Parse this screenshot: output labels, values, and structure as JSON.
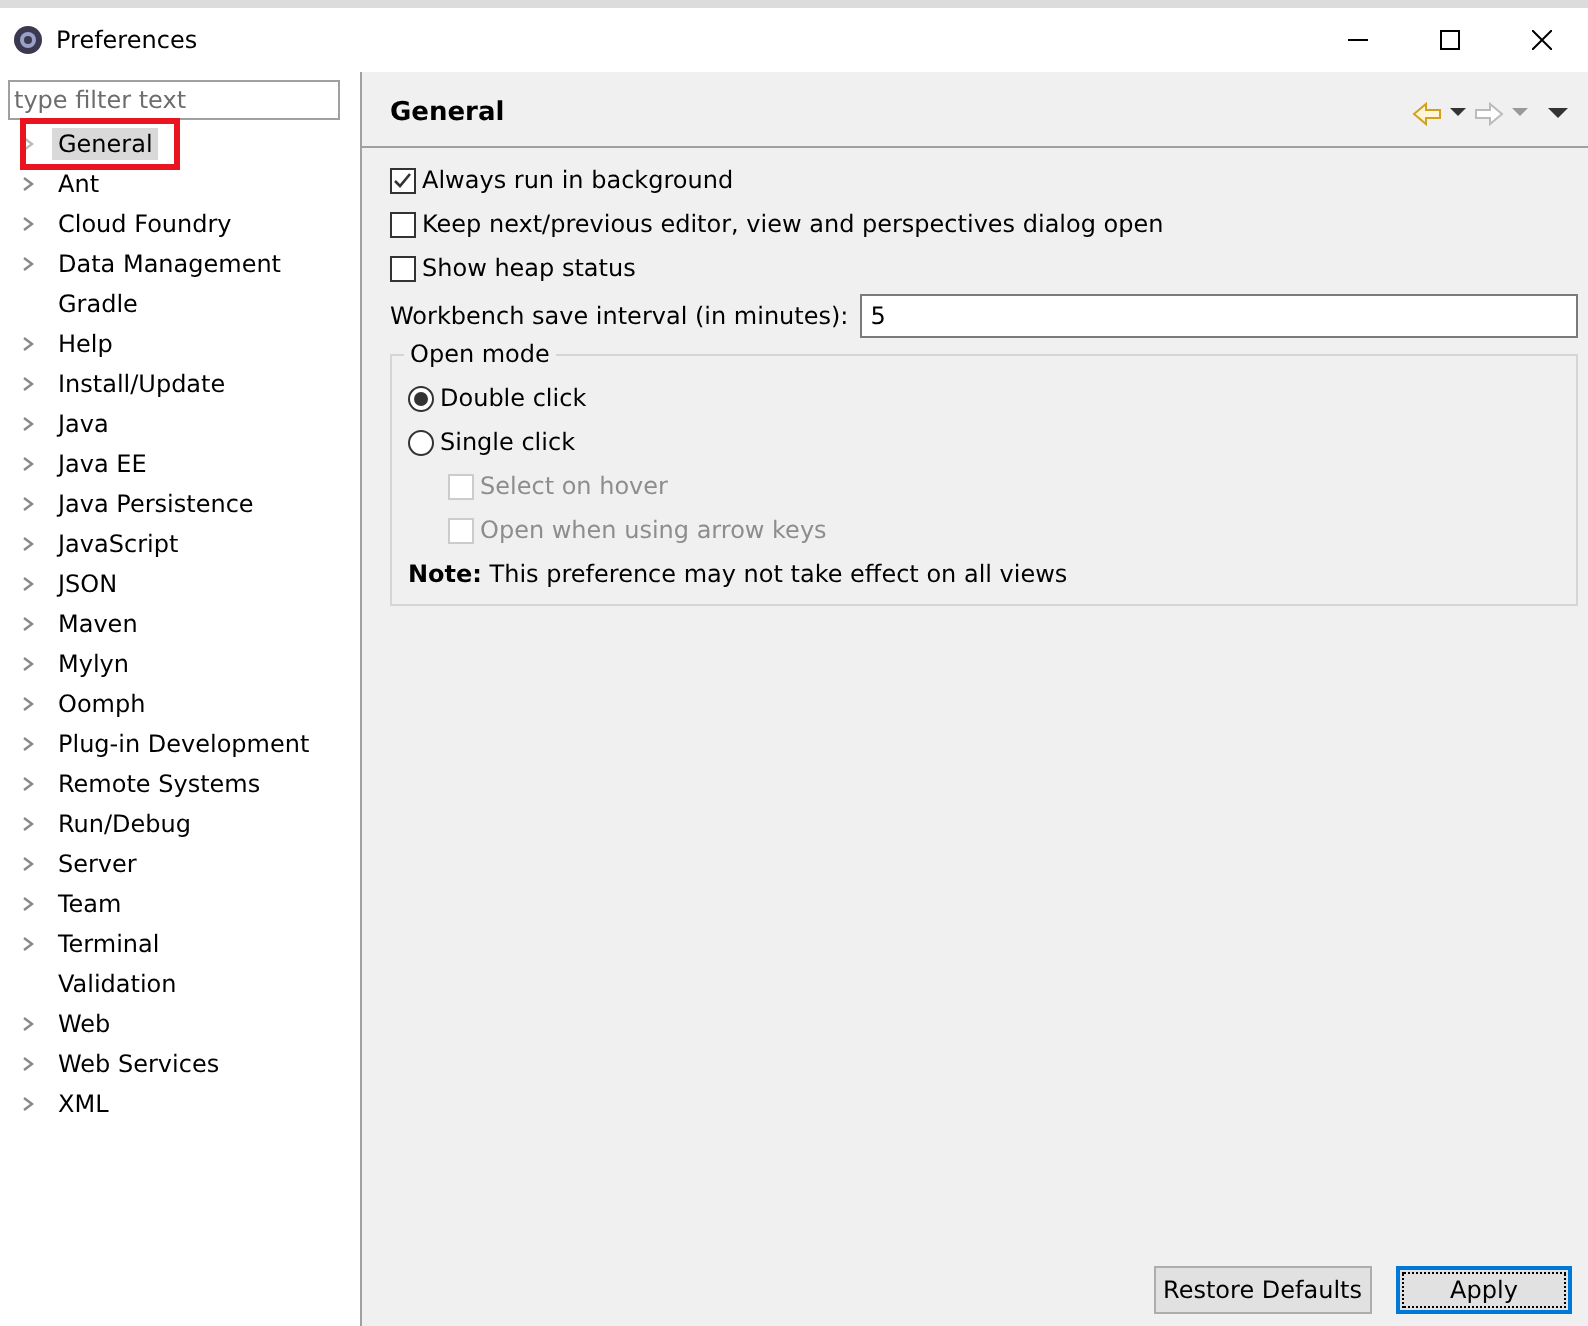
{
  "window": {
    "title": "Preferences"
  },
  "filter": {
    "placeholder": "type filter text"
  },
  "tree": [
    {
      "label": "General",
      "expandable": true,
      "selected": true,
      "annotated": true
    },
    {
      "label": "Ant",
      "expandable": true,
      "selected": false,
      "annotated": false
    },
    {
      "label": "Cloud Foundry",
      "expandable": true,
      "selected": false,
      "annotated": false
    },
    {
      "label": "Data Management",
      "expandable": true,
      "selected": false,
      "annotated": false
    },
    {
      "label": "Gradle",
      "expandable": false,
      "selected": false,
      "annotated": false
    },
    {
      "label": "Help",
      "expandable": true,
      "selected": false,
      "annotated": false
    },
    {
      "label": "Install/Update",
      "expandable": true,
      "selected": false,
      "annotated": false
    },
    {
      "label": "Java",
      "expandable": true,
      "selected": false,
      "annotated": false
    },
    {
      "label": "Java EE",
      "expandable": true,
      "selected": false,
      "annotated": false
    },
    {
      "label": "Java Persistence",
      "expandable": true,
      "selected": false,
      "annotated": false
    },
    {
      "label": "JavaScript",
      "expandable": true,
      "selected": false,
      "annotated": false
    },
    {
      "label": "JSON",
      "expandable": true,
      "selected": false,
      "annotated": false
    },
    {
      "label": "Maven",
      "expandable": true,
      "selected": false,
      "annotated": false
    },
    {
      "label": "Mylyn",
      "expandable": true,
      "selected": false,
      "annotated": false
    },
    {
      "label": "Oomph",
      "expandable": true,
      "selected": false,
      "annotated": false
    },
    {
      "label": "Plug-in Development",
      "expandable": true,
      "selected": false,
      "annotated": false
    },
    {
      "label": "Remote Systems",
      "expandable": true,
      "selected": false,
      "annotated": false
    },
    {
      "label": "Run/Debug",
      "expandable": true,
      "selected": false,
      "annotated": false
    },
    {
      "label": "Server",
      "expandable": true,
      "selected": false,
      "annotated": false
    },
    {
      "label": "Team",
      "expandable": true,
      "selected": false,
      "annotated": false
    },
    {
      "label": "Terminal",
      "expandable": true,
      "selected": false,
      "annotated": false
    },
    {
      "label": "Validation",
      "expandable": false,
      "selected": false,
      "annotated": false
    },
    {
      "label": "Web",
      "expandable": true,
      "selected": false,
      "annotated": false
    },
    {
      "label": "Web Services",
      "expandable": true,
      "selected": false,
      "annotated": false
    },
    {
      "label": "XML",
      "expandable": true,
      "selected": false,
      "annotated": false
    }
  ],
  "page": {
    "title": "General",
    "options": [
      {
        "label": "Always run in background",
        "checked": true
      },
      {
        "label": "Keep next/previous editor, view and perspectives dialog open",
        "checked": false
      },
      {
        "label": "Show heap status",
        "checked": false
      }
    ],
    "save_interval": {
      "label": "Workbench save interval (in minutes):",
      "value": "5"
    },
    "open_mode": {
      "title": "Open mode",
      "radios": [
        {
          "label": "Double click",
          "selected": true
        },
        {
          "label": "Single click",
          "selected": false
        }
      ],
      "sub_options": [
        {
          "label": "Select on hover",
          "checked": false,
          "disabled": true
        },
        {
          "label": "Open when using arrow keys",
          "checked": false,
          "disabled": true
        }
      ],
      "note": "**Note:** This preference may not take effect on all views"
    }
  },
  "buttons": [
    {
      "label": "Restore Defaults",
      "default": false
    },
    {
      "label": "Apply",
      "default": true
    }
  ]
}
